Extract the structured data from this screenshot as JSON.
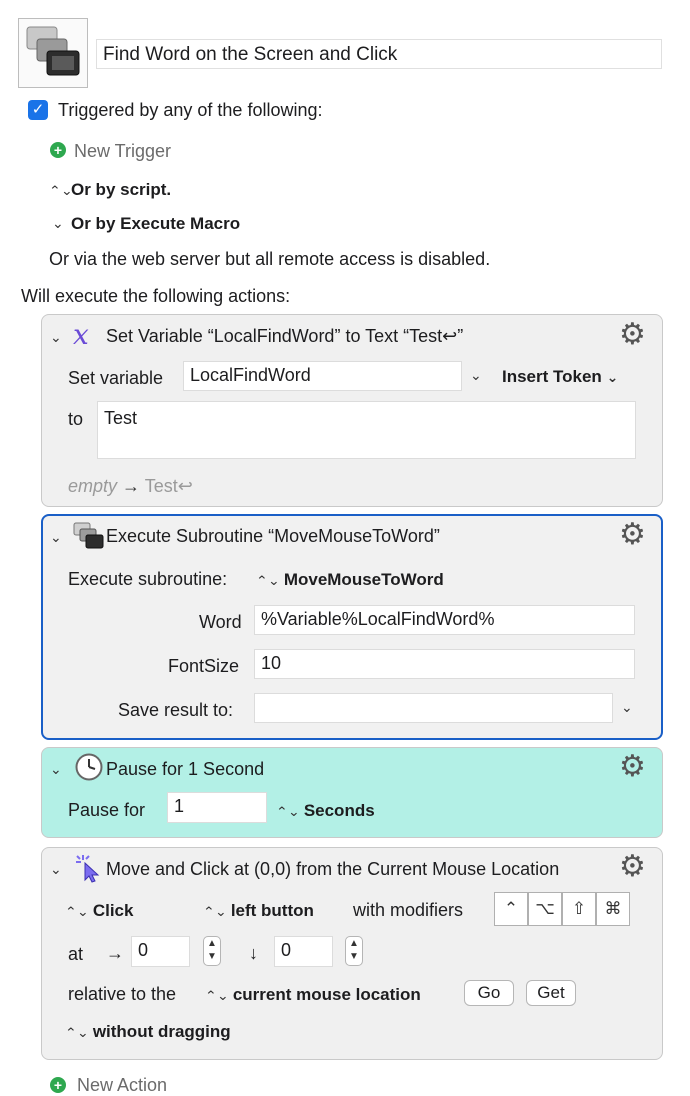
{
  "macro": {
    "name": "Find Word on the Screen and Click",
    "triggered_label": "Triggered by any of the following:",
    "new_trigger": "New Trigger",
    "or_by_script": "Or by script.",
    "or_by_execute_macro": "Or by Execute Macro",
    "web_server_text": "Or via the web server but all remote access is disabled.",
    "will_execute": "Will execute the following actions:",
    "new_action": "New Action"
  },
  "actions": {
    "set_variable": {
      "title": "Set Variable “LocalFindWord” to Text “Test↩”",
      "set_variable_label": "Set variable",
      "variable_name": "LocalFindWord",
      "insert_token": "Insert Token",
      "to_label": "to",
      "text_value": "Test",
      "preview_empty": "empty",
      "preview_arrow": "→",
      "preview_value": "Test↩"
    },
    "execute_subroutine": {
      "title": "Execute Subroutine “MoveMouseToWord”",
      "execute_label": "Execute subroutine:",
      "subroutine": "MoveMouseToWord",
      "word_label": "Word",
      "word_value": "%Variable%LocalFindWord%",
      "fontsize_label": "FontSize",
      "fontsize_value": "10",
      "save_result_label": "Save result to:",
      "save_result_value": ""
    },
    "pause": {
      "title": "Pause for 1 Second",
      "pause_label": "Pause for",
      "pause_value": "1",
      "unit": "Seconds"
    },
    "move_click": {
      "title": "Move and Click at (0,0) from the Current Mouse Location",
      "click_type": "Click",
      "button": "left button",
      "with_modifiers": "with modifiers",
      "modifiers": [
        "⌃",
        "⌥",
        "⇧",
        "⌘"
      ],
      "at_label": "at",
      "x_arrow": "→",
      "x_value": "0",
      "y_arrow": "↓",
      "y_value": "0",
      "relative_label": "relative to the",
      "relative_value": "current mouse location",
      "go": "Go",
      "get": "Get",
      "dragging": "without dragging"
    }
  },
  "colors": {
    "accent": "#1a73e8",
    "selected_border": "#1a5fc7",
    "pause_bg": "#b3f0e6",
    "add_green": "#2ea84f",
    "variable_icon": "#6a4bd6"
  },
  "icons": {
    "macro_group": "stacked-windows-icon",
    "set_variable": "variable-x-icon",
    "subroutine": "stacked-windows-icon",
    "pause": "clock-icon",
    "move_click": "pointer-click-icon",
    "settings": "gear-icon"
  }
}
